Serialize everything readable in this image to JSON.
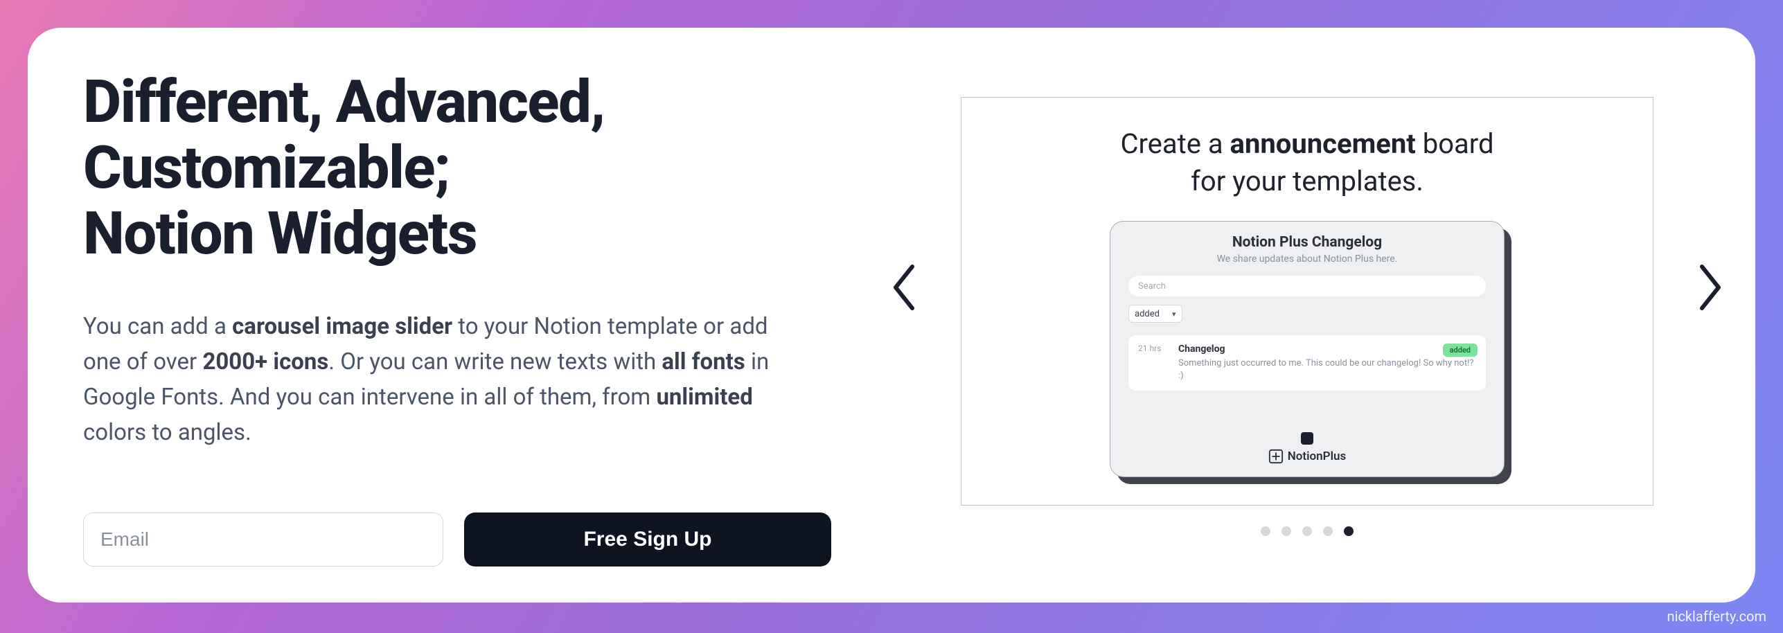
{
  "heading_line1": "Different, Advanced,",
  "heading_line2": "Customizable;",
  "heading_line3": "Notion Widgets",
  "desc": {
    "p1a": "You can add a ",
    "p1b": "carousel image slider",
    "p1c": " to your Notion template or add one of over ",
    "p1d": "2000+ icons",
    "p1e": ". Or you can write new texts with ",
    "p1f": "all fonts",
    "p1g": " in Google Fonts. And you can intervene in all of them, from ",
    "p1h": "unlimited",
    "p1i": " colors to angles."
  },
  "form": {
    "email_placeholder": "Email",
    "signup_label": "Free Sign Up"
  },
  "slide": {
    "title_a": "Create a ",
    "title_b": "announcement",
    "title_c": " board",
    "title_d": "for your templates."
  },
  "widget": {
    "heading": "Notion Plus Changelog",
    "sub": "We share updates about Notion Plus here.",
    "search_placeholder": "Search",
    "filter_value": "added",
    "entry": {
      "time": "21 hrs",
      "title": "Changelog",
      "text": "Something just occurred to me. This could be our changelog! So why not!? :)",
      "badge": "added"
    },
    "brand": "NotionPlus"
  },
  "dots": {
    "count": 5,
    "active": 4
  },
  "watermark": "nicklafferty.com"
}
